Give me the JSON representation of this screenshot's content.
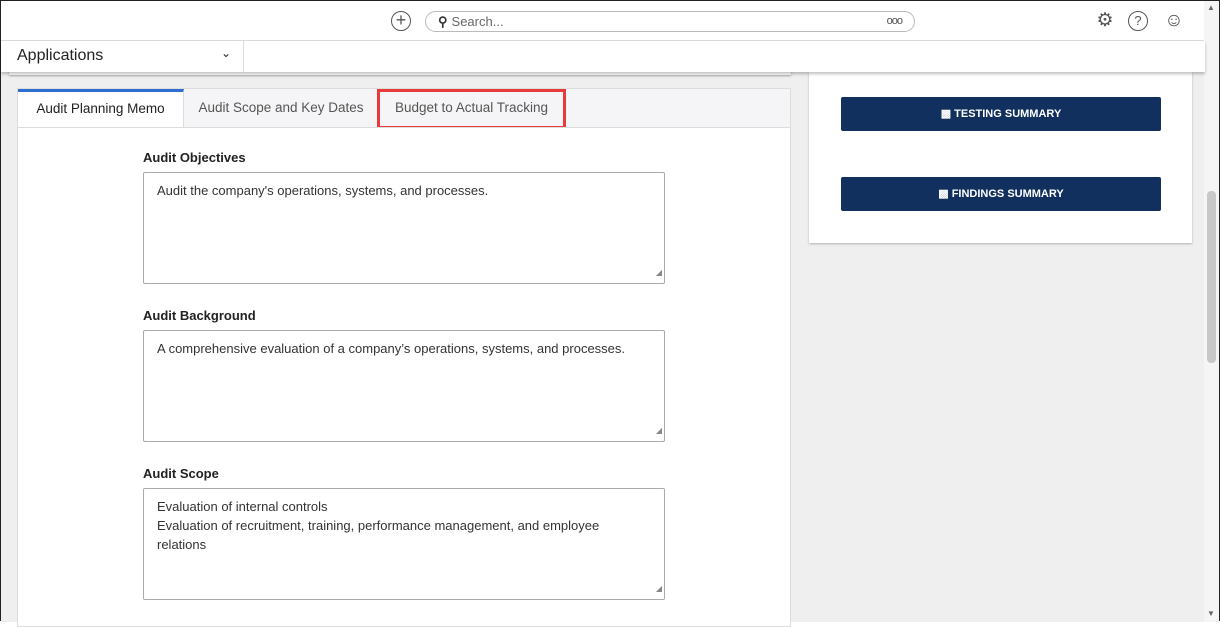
{
  "topbar": {
    "search_placeholder": "Search...",
    "search_more": "ooo"
  },
  "appbar": {
    "applications_label": "Applications"
  },
  "tabs": [
    {
      "label": "Audit Planning Memo",
      "active": true
    },
    {
      "label": "Audit Scope and Key Dates"
    },
    {
      "label": "Budget to Actual Tracking",
      "highlighted": true
    }
  ],
  "fields": [
    {
      "label": "Audit Objectives",
      "value": "Audit the company's operations, systems, and processes."
    },
    {
      "label": "Audit Background",
      "value": "A comprehensive evaluation of a company’s operations, systems, and processes."
    },
    {
      "label": "Audit Scope",
      "value": "Evaluation of internal controls\nEvaluation of recruitment, training, performance management, and employee relations"
    }
  ],
  "buttons": {
    "testing_summary": "TESTING SUMMARY",
    "findings_summary": "FINDINGS SUMMARY"
  },
  "colors": {
    "button": "#12305e",
    "highlight": "#e83b3b",
    "active_tab": "#2c6fcf"
  }
}
